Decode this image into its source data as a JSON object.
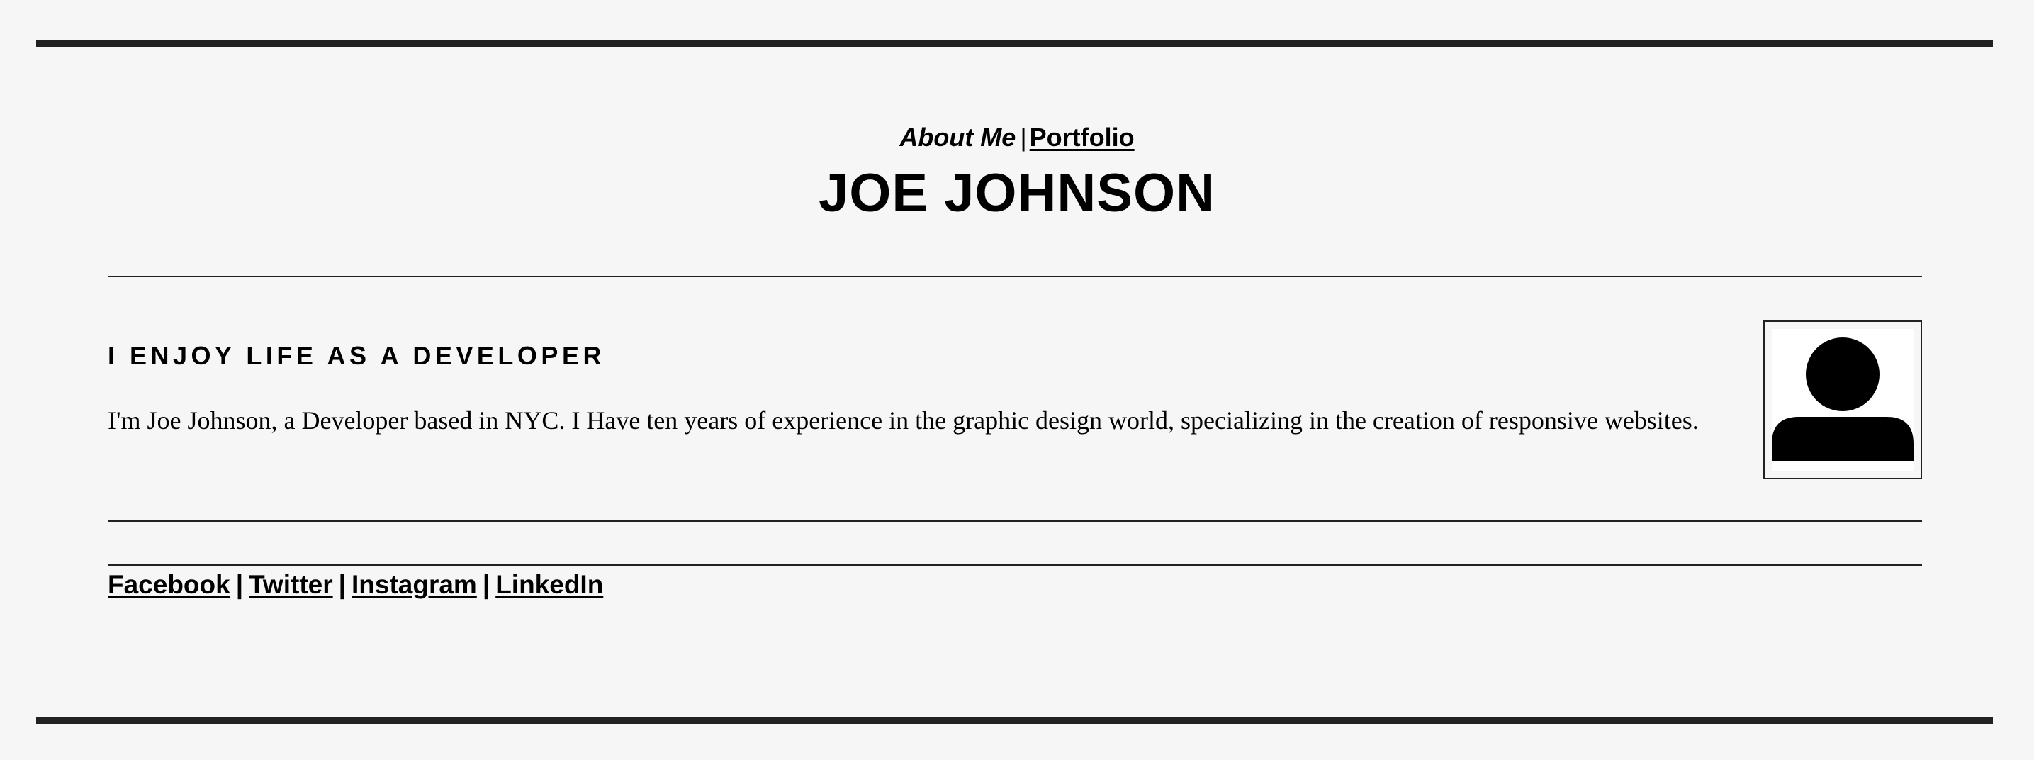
{
  "nav": {
    "about_label": "About Me",
    "separator": "|",
    "portfolio_label": "Portfolio"
  },
  "header": {
    "title": "JOE JOHNSON"
  },
  "about": {
    "tagline": "I ENJOY LIFE AS A DEVELOPER",
    "bio": "I'm Joe Johnson, a Developer based in NYC. I Have ten years of experience in the graphic design world, specializing in the creation of responsive websites.",
    "avatar_icon": "user-icon"
  },
  "social": {
    "links": [
      {
        "label": "Facebook"
      },
      {
        "label": "Twitter"
      },
      {
        "label": "Instagram"
      },
      {
        "label": "LinkedIn"
      }
    ],
    "separator": "|"
  },
  "colors": {
    "background": "#f6f6f6",
    "border": "#222222",
    "text": "#000000"
  }
}
